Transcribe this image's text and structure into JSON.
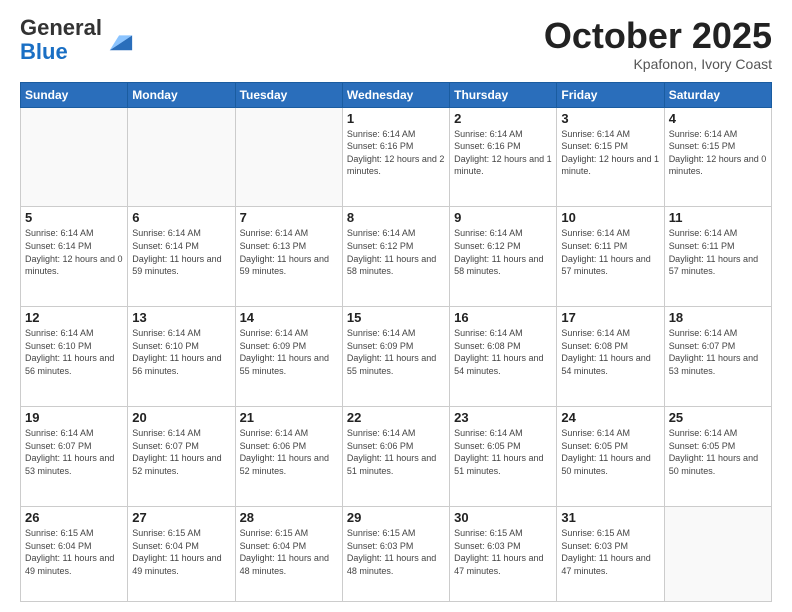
{
  "logo": {
    "general": "General",
    "blue": "Blue"
  },
  "header": {
    "month": "October 2025",
    "location": "Kpafonon, Ivory Coast"
  },
  "weekdays": [
    "Sunday",
    "Monday",
    "Tuesday",
    "Wednesday",
    "Thursday",
    "Friday",
    "Saturday"
  ],
  "weeks": [
    [
      {
        "day": "",
        "sunrise": "",
        "sunset": "",
        "daylight": ""
      },
      {
        "day": "",
        "sunrise": "",
        "sunset": "",
        "daylight": ""
      },
      {
        "day": "",
        "sunrise": "",
        "sunset": "",
        "daylight": ""
      },
      {
        "day": "1",
        "sunrise": "Sunrise: 6:14 AM",
        "sunset": "Sunset: 6:16 PM",
        "daylight": "Daylight: 12 hours and 2 minutes."
      },
      {
        "day": "2",
        "sunrise": "Sunrise: 6:14 AM",
        "sunset": "Sunset: 6:16 PM",
        "daylight": "Daylight: 12 hours and 1 minute."
      },
      {
        "day": "3",
        "sunrise": "Sunrise: 6:14 AM",
        "sunset": "Sunset: 6:15 PM",
        "daylight": "Daylight: 12 hours and 1 minute."
      },
      {
        "day": "4",
        "sunrise": "Sunrise: 6:14 AM",
        "sunset": "Sunset: 6:15 PM",
        "daylight": "Daylight: 12 hours and 0 minutes."
      }
    ],
    [
      {
        "day": "5",
        "sunrise": "Sunrise: 6:14 AM",
        "sunset": "Sunset: 6:14 PM",
        "daylight": "Daylight: 12 hours and 0 minutes."
      },
      {
        "day": "6",
        "sunrise": "Sunrise: 6:14 AM",
        "sunset": "Sunset: 6:14 PM",
        "daylight": "Daylight: 11 hours and 59 minutes."
      },
      {
        "day": "7",
        "sunrise": "Sunrise: 6:14 AM",
        "sunset": "Sunset: 6:13 PM",
        "daylight": "Daylight: 11 hours and 59 minutes."
      },
      {
        "day": "8",
        "sunrise": "Sunrise: 6:14 AM",
        "sunset": "Sunset: 6:12 PM",
        "daylight": "Daylight: 11 hours and 58 minutes."
      },
      {
        "day": "9",
        "sunrise": "Sunrise: 6:14 AM",
        "sunset": "Sunset: 6:12 PM",
        "daylight": "Daylight: 11 hours and 58 minutes."
      },
      {
        "day": "10",
        "sunrise": "Sunrise: 6:14 AM",
        "sunset": "Sunset: 6:11 PM",
        "daylight": "Daylight: 11 hours and 57 minutes."
      },
      {
        "day": "11",
        "sunrise": "Sunrise: 6:14 AM",
        "sunset": "Sunset: 6:11 PM",
        "daylight": "Daylight: 11 hours and 57 minutes."
      }
    ],
    [
      {
        "day": "12",
        "sunrise": "Sunrise: 6:14 AM",
        "sunset": "Sunset: 6:10 PM",
        "daylight": "Daylight: 11 hours and 56 minutes."
      },
      {
        "day": "13",
        "sunrise": "Sunrise: 6:14 AM",
        "sunset": "Sunset: 6:10 PM",
        "daylight": "Daylight: 11 hours and 56 minutes."
      },
      {
        "day": "14",
        "sunrise": "Sunrise: 6:14 AM",
        "sunset": "Sunset: 6:09 PM",
        "daylight": "Daylight: 11 hours and 55 minutes."
      },
      {
        "day": "15",
        "sunrise": "Sunrise: 6:14 AM",
        "sunset": "Sunset: 6:09 PM",
        "daylight": "Daylight: 11 hours and 55 minutes."
      },
      {
        "day": "16",
        "sunrise": "Sunrise: 6:14 AM",
        "sunset": "Sunset: 6:08 PM",
        "daylight": "Daylight: 11 hours and 54 minutes."
      },
      {
        "day": "17",
        "sunrise": "Sunrise: 6:14 AM",
        "sunset": "Sunset: 6:08 PM",
        "daylight": "Daylight: 11 hours and 54 minutes."
      },
      {
        "day": "18",
        "sunrise": "Sunrise: 6:14 AM",
        "sunset": "Sunset: 6:07 PM",
        "daylight": "Daylight: 11 hours and 53 minutes."
      }
    ],
    [
      {
        "day": "19",
        "sunrise": "Sunrise: 6:14 AM",
        "sunset": "Sunset: 6:07 PM",
        "daylight": "Daylight: 11 hours and 53 minutes."
      },
      {
        "day": "20",
        "sunrise": "Sunrise: 6:14 AM",
        "sunset": "Sunset: 6:07 PM",
        "daylight": "Daylight: 11 hours and 52 minutes."
      },
      {
        "day": "21",
        "sunrise": "Sunrise: 6:14 AM",
        "sunset": "Sunset: 6:06 PM",
        "daylight": "Daylight: 11 hours and 52 minutes."
      },
      {
        "day": "22",
        "sunrise": "Sunrise: 6:14 AM",
        "sunset": "Sunset: 6:06 PM",
        "daylight": "Daylight: 11 hours and 51 minutes."
      },
      {
        "day": "23",
        "sunrise": "Sunrise: 6:14 AM",
        "sunset": "Sunset: 6:05 PM",
        "daylight": "Daylight: 11 hours and 51 minutes."
      },
      {
        "day": "24",
        "sunrise": "Sunrise: 6:14 AM",
        "sunset": "Sunset: 6:05 PM",
        "daylight": "Daylight: 11 hours and 50 minutes."
      },
      {
        "day": "25",
        "sunrise": "Sunrise: 6:14 AM",
        "sunset": "Sunset: 6:05 PM",
        "daylight": "Daylight: 11 hours and 50 minutes."
      }
    ],
    [
      {
        "day": "26",
        "sunrise": "Sunrise: 6:15 AM",
        "sunset": "Sunset: 6:04 PM",
        "daylight": "Daylight: 11 hours and 49 minutes."
      },
      {
        "day": "27",
        "sunrise": "Sunrise: 6:15 AM",
        "sunset": "Sunset: 6:04 PM",
        "daylight": "Daylight: 11 hours and 49 minutes."
      },
      {
        "day": "28",
        "sunrise": "Sunrise: 6:15 AM",
        "sunset": "Sunset: 6:04 PM",
        "daylight": "Daylight: 11 hours and 48 minutes."
      },
      {
        "day": "29",
        "sunrise": "Sunrise: 6:15 AM",
        "sunset": "Sunset: 6:03 PM",
        "daylight": "Daylight: 11 hours and 48 minutes."
      },
      {
        "day": "30",
        "sunrise": "Sunrise: 6:15 AM",
        "sunset": "Sunset: 6:03 PM",
        "daylight": "Daylight: 11 hours and 47 minutes."
      },
      {
        "day": "31",
        "sunrise": "Sunrise: 6:15 AM",
        "sunset": "Sunset: 6:03 PM",
        "daylight": "Daylight: 11 hours and 47 minutes."
      },
      {
        "day": "",
        "sunrise": "",
        "sunset": "",
        "daylight": ""
      }
    ]
  ]
}
